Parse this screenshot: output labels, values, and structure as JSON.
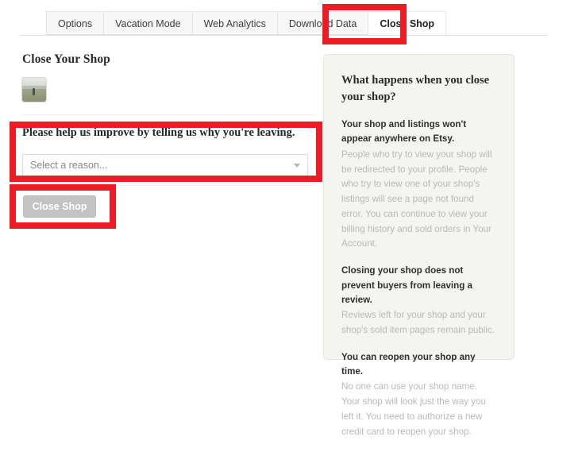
{
  "tabs": [
    {
      "label": "Options",
      "active": false
    },
    {
      "label": "Vacation Mode",
      "active": false
    },
    {
      "label": "Web Analytics",
      "active": false
    },
    {
      "label": "Download Data",
      "active": false
    },
    {
      "label": "Close Shop",
      "active": true
    }
  ],
  "main": {
    "page_title": "Close Your Shop",
    "thumbnail_name": "shop-thumbnail",
    "reason_label": "Please help us improve by telling us why you're leaving.",
    "select": {
      "value": "Select a reason...",
      "placeholder": "Select a reason...",
      "caret_icon": "chevron-down-icon"
    },
    "close_button": {
      "label": "Close Shop",
      "disabled": true
    }
  },
  "info_panel": {
    "heading": "What happens when you close your shop?",
    "blocks": [
      {
        "strong": "Your shop and listings won't appear anywhere on Etsy.",
        "body": "People who try to view your shop will be redirected to your profile. People who try to view one of your shop's listings will see a page not found error. You can continue to view your billing history and sold orders in Your Account."
      },
      {
        "strong": "Closing your shop does not prevent buyers from leaving a review.",
        "body": "Reviews left for your shop and your shop's sold item pages remain public."
      },
      {
        "strong": "You can reopen your shop any time.",
        "body": "No one can use your shop name. Your shop will look just the way you left it. You need to authorize a new credit card to reopen your shop."
      }
    ]
  },
  "annotations": {
    "color": "#ed1c24",
    "boxes": [
      {
        "name": "close-shop-tab-highlight"
      },
      {
        "name": "reason-section-highlight"
      },
      {
        "name": "close-shop-button-highlight"
      }
    ]
  }
}
